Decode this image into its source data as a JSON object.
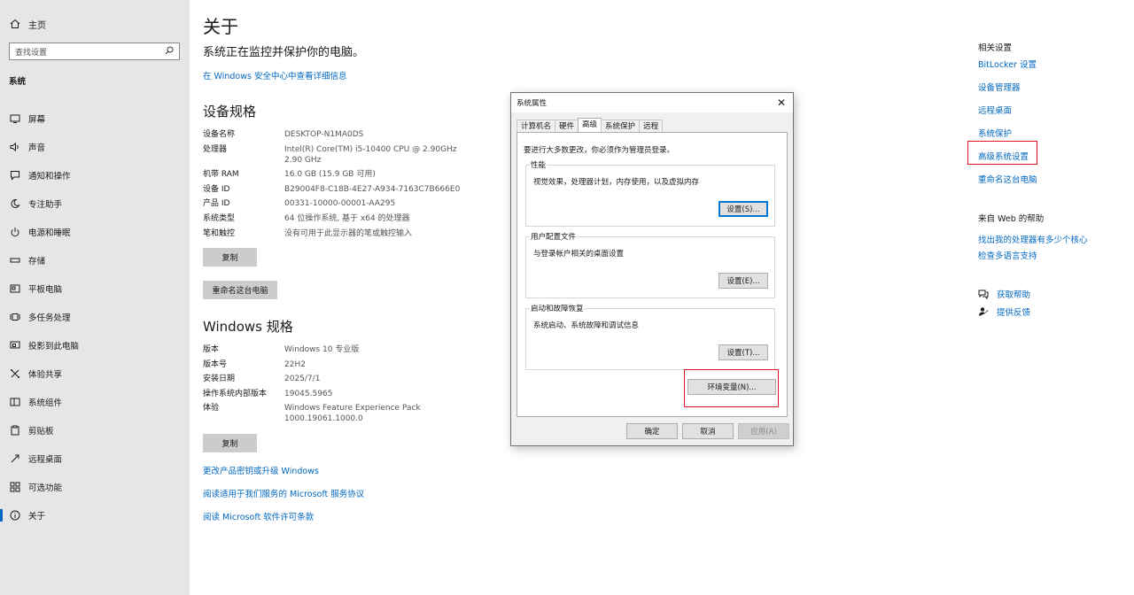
{
  "sidebar": {
    "home_label": "主页",
    "search_placeholder": "查找设置",
    "section": "系统",
    "items": [
      {
        "label": "屏幕",
        "icon": "monitor-icon"
      },
      {
        "label": "声音",
        "icon": "speaker-icon"
      },
      {
        "label": "通知和操作",
        "icon": "notification-icon"
      },
      {
        "label": "专注助手",
        "icon": "moon-icon"
      },
      {
        "label": "电源和睡眠",
        "icon": "power-icon"
      },
      {
        "label": "存储",
        "icon": "storage-icon"
      },
      {
        "label": "平板电脑",
        "icon": "tablet-icon"
      },
      {
        "label": "多任务处理",
        "icon": "multitask-icon"
      },
      {
        "label": "投影到此电脑",
        "icon": "project-icon"
      },
      {
        "label": "体验共享",
        "icon": "share-icon"
      },
      {
        "label": "系统组件",
        "icon": "components-icon"
      },
      {
        "label": "剪贴板",
        "icon": "clipboard-icon"
      },
      {
        "label": "远程桌面",
        "icon": "remote-icon"
      },
      {
        "label": "可选功能",
        "icon": "optional-features-icon"
      },
      {
        "label": "关于",
        "icon": "info-icon",
        "active": true
      }
    ]
  },
  "main": {
    "title": "关于",
    "status": "系统正在监控并保护你的电脑。",
    "security_link": "在 Windows 安全中心中查看详细信息",
    "device_spec": {
      "title": "设备规格",
      "rows": [
        {
          "k": "设备名称",
          "v": "DESKTOP-N1MA0DS"
        },
        {
          "k": "处理器",
          "v": "Intel(R) Core(TM) i5-10400 CPU @ 2.90GHz   2.90 GHz"
        },
        {
          "k": "机带 RAM",
          "v": "16.0 GB (15.9 GB 可用)"
        },
        {
          "k": "设备 ID",
          "v": "B29004F8-C18B-4E27-A934-7163C7B666E0"
        },
        {
          "k": "产品 ID",
          "v": "00331-10000-00001-AA295"
        },
        {
          "k": "系统类型",
          "v": "64 位操作系统, 基于 x64 的处理器"
        },
        {
          "k": "笔和触控",
          "v": "没有可用于此显示器的笔或触控输入"
        }
      ],
      "copy_button": "复制",
      "rename_button": "重命名这台电脑"
    },
    "windows_spec": {
      "title": "Windows 规格",
      "rows": [
        {
          "k": "版本",
          "v": "Windows 10 专业版"
        },
        {
          "k": "版本号",
          "v": "22H2"
        },
        {
          "k": "安装日期",
          "v": "2025/7/1"
        },
        {
          "k": "操作系统内部版本",
          "v": "19045.5965"
        },
        {
          "k": "体验",
          "v": "Windows Feature Experience Pack 1000.19061.1000.0"
        }
      ],
      "copy_button": "复制"
    },
    "links": [
      "更改产品密钥或升级 Windows",
      "阅读适用于我们服务的 Microsoft 服务协议",
      "阅读 Microsoft 软件许可条款"
    ]
  },
  "right": {
    "related_title": "相关设置",
    "related_links": [
      "BitLocker 设置",
      "设备管理器",
      "远程桌面",
      "系统保护",
      "高级系统设置",
      "重命名这台电脑"
    ],
    "web_help_title": "来自 Web 的帮助",
    "web_links": [
      "找出我的处理器有多少个核心",
      "检查多语言支持"
    ],
    "get_help": "获取帮助",
    "feedback": "提供反馈"
  },
  "dialog": {
    "title": "系统属性",
    "tabs": [
      "计算机名",
      "硬件",
      "高级",
      "系统保护",
      "远程"
    ],
    "active_tab": "高级",
    "note": "要进行大多数更改，你必须作为管理员登录。",
    "groups": [
      {
        "title": "性能",
        "desc": "视觉效果，处理器计划，内存使用，以及虚拟内存",
        "button": "设置(S)..."
      },
      {
        "title": "用户配置文件",
        "desc": "与登录帐户相关的桌面设置",
        "button": "设置(E)..."
      },
      {
        "title": "启动和故障恢复",
        "desc": "系统启动、系统故障和调试信息",
        "button": "设置(T)..."
      }
    ],
    "env_button": "环境变量(N)...",
    "ok": "确定",
    "cancel": "取消",
    "apply": "应用(A)"
  },
  "colors": {
    "accent": "#0067c0",
    "highlight_border": "#e81123",
    "sidebar_bg": "#e6e6e6"
  }
}
